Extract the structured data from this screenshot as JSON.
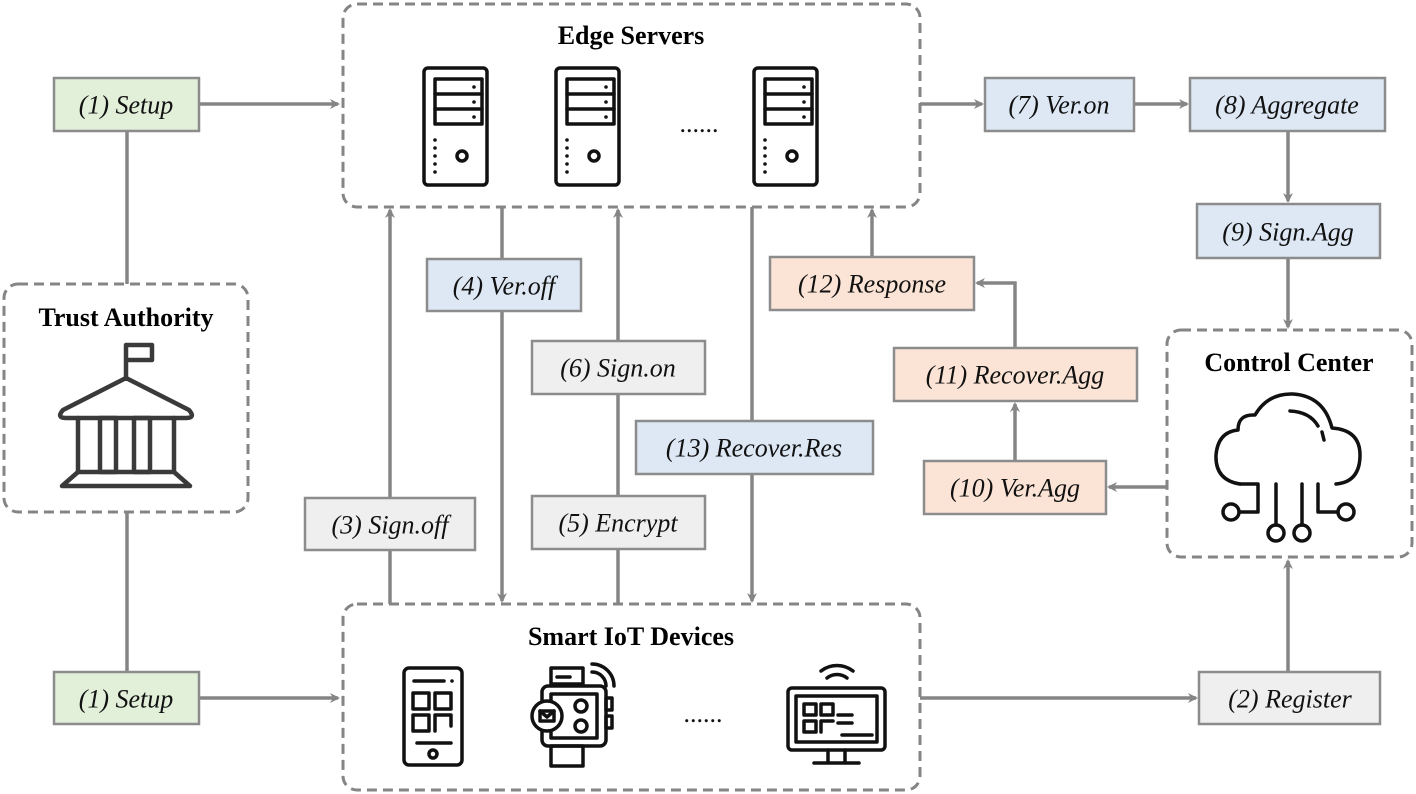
{
  "colors": {
    "setup": "#e2efd9",
    "verify": "#dde8f4",
    "recover": "#fbe4d6",
    "neutral": "#efefef",
    "line": "#858585"
  },
  "groups": {
    "edge_servers": "Edge Servers",
    "iot_devices": "Smart IoT Devices",
    "trust_authority": "Trust Authority",
    "control_center": "Control Center"
  },
  "ellipsis": "......",
  "steps": {
    "setup_top": "(1) Setup",
    "setup_bottom": "(1) Setup",
    "register": "(2) Register",
    "sign_off": "(3) Sign.off",
    "ver_off": "(4) Ver.off",
    "encrypt": "(5) Encrypt",
    "sign_on": "(6) Sign.on",
    "ver_on": "(7) Ver.on",
    "aggregate": "(8) Aggregate",
    "sign_agg": "(9) Sign.Agg",
    "ver_agg": "(10) Ver.Agg",
    "recover_agg": "(11) Recover.Agg",
    "response": "(12) Response",
    "recover_res": "(13) Recover.Res"
  },
  "icons": [
    "server-icon",
    "smartphone-icon",
    "smartwatch-icon",
    "smart-monitor-icon",
    "government-building-icon",
    "cloud-network-icon"
  ]
}
